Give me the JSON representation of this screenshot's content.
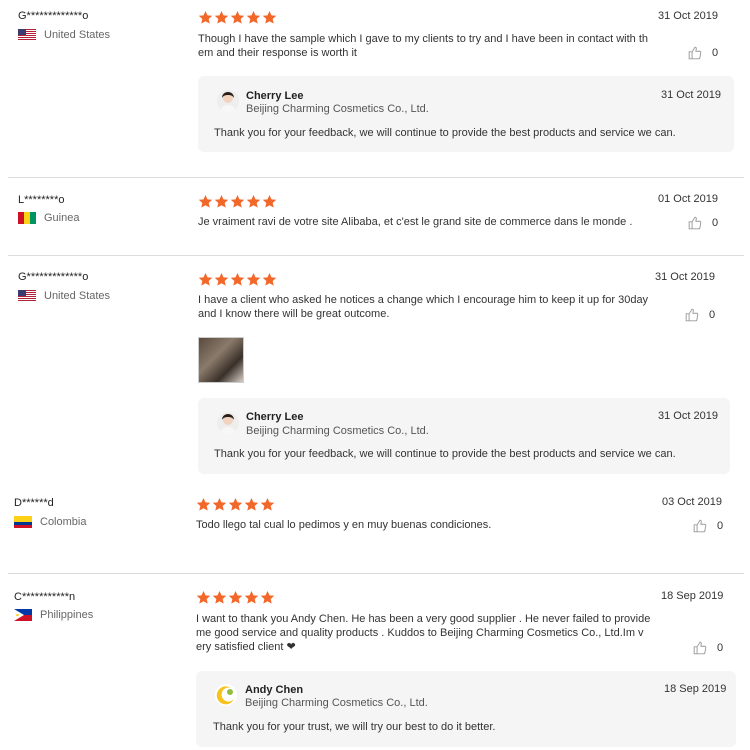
{
  "reviews": [
    {
      "user": "G*************o",
      "country": "United States",
      "flag": "us",
      "date": "31 Oct 2019",
      "text_lines": [
        "Though I have the sample which I gave to my clients to try and I have been in contact with th",
        "em and their response is worth it"
      ],
      "likes": "0",
      "reply": {
        "name": "Cherry Lee",
        "company": "Beijing Charming Cosmetics Co., Ltd.",
        "date": "31 Oct 2019",
        "text": "Thank you for your feedback, we will continue to provide the best products and service we can."
      }
    },
    {
      "user": "L********o",
      "country": "Guinea",
      "flag": "gn",
      "date": "01 Oct 2019",
      "text_lines": [
        "Je vraiment ravi de votre site Alibaba, et c'est le grand site de commerce dans le monde ."
      ],
      "likes": "0"
    },
    {
      "user": "G*************o",
      "country": "United States",
      "flag": "us",
      "date": "31 Oct 2019",
      "text_lines": [
        "I have a client who asked he notices a change which I encourage him to keep it up for 30day",
        "and I know there will be great outcome."
      ],
      "likes": "0",
      "reply": {
        "name": "Cherry Lee",
        "company": "Beijing Charming Cosmetics Co., Ltd.",
        "date": "31 Oct 2019",
        "text": "Thank you for your feedback, we will continue to provide the best products and service we can."
      }
    },
    {
      "user": "D******d",
      "country": "Colombia",
      "flag": "co",
      "date": "03 Oct 2019",
      "text_lines": [
        "Todo llego tal cual lo pedimos y en muy buenas condiciones."
      ],
      "likes": "0"
    },
    {
      "user": "C***********n",
      "country": "Philippines",
      "flag": "ph",
      "date": "18 Sep 2019",
      "text_lines": [
        "I want to thank you Andy Chen. He has been a very good supplier . He never failed to provide",
        "me good service and quality products . Kuddos to Beijing Charming Cosmetics Co., Ltd.Im v",
        "ery satisfied client ❤"
      ],
      "likes": "0",
      "reply": {
        "name": "Andy Chen",
        "company": "Beijing Charming Cosmetics Co., Ltd.",
        "date": "18 Sep 2019",
        "text": "Thank you for your trust, we will try our best to do it better."
      }
    }
  ],
  "colors": {
    "star": "#f2682a",
    "reply_bg": "#f5f5f5"
  }
}
